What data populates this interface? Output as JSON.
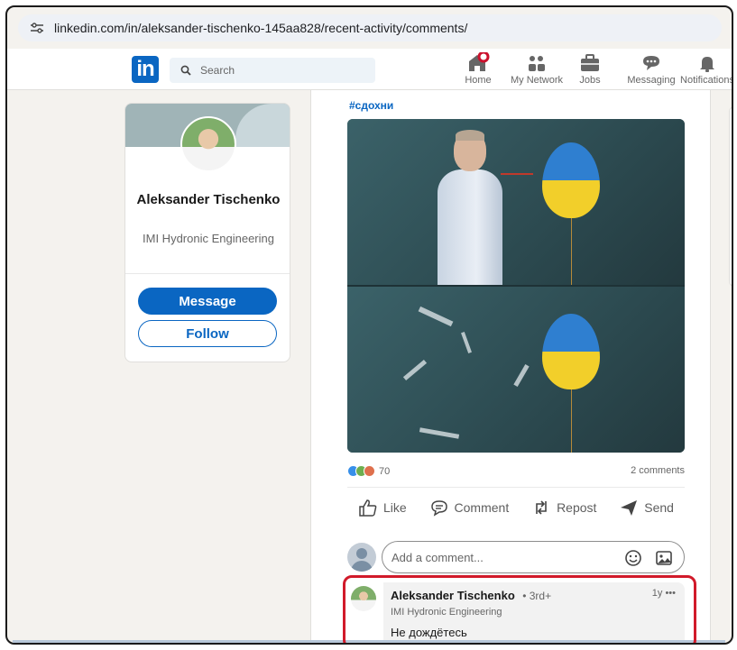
{
  "browser": {
    "url": "linkedin.com/in/aleksander-tischenko-145aa828/recent-activity/comments/"
  },
  "nav": {
    "search_placeholder": "Search",
    "items": [
      {
        "label": "Home",
        "icon": "home-icon"
      },
      {
        "label": "My Network",
        "icon": "network-icon"
      },
      {
        "label": "Jobs",
        "icon": "briefcase-icon"
      },
      {
        "label": "Messaging",
        "icon": "message-icon"
      },
      {
        "label": "Notifications",
        "icon": "bell-icon"
      }
    ]
  },
  "profile": {
    "name": "Aleksander Tischenko",
    "company": "IMI Hydronic Engineering",
    "message_label": "Message",
    "follow_label": "Follow"
  },
  "post": {
    "hashtag": "#сдохни",
    "reaction_count": "70",
    "comments_count": "2 comments",
    "actions": {
      "like": "Like",
      "comment": "Comment",
      "repost": "Repost",
      "send": "Send"
    },
    "comment_placeholder": "Add a comment..."
  },
  "comment": {
    "author": "Aleksander Tischenko",
    "degree": "• 3rd+",
    "title": "IMI Hydronic Engineering",
    "time": "1y •••",
    "text": "Не дождётесь"
  },
  "colors": {
    "brand": "#0a66c2",
    "highlight": "#d11a2a"
  }
}
